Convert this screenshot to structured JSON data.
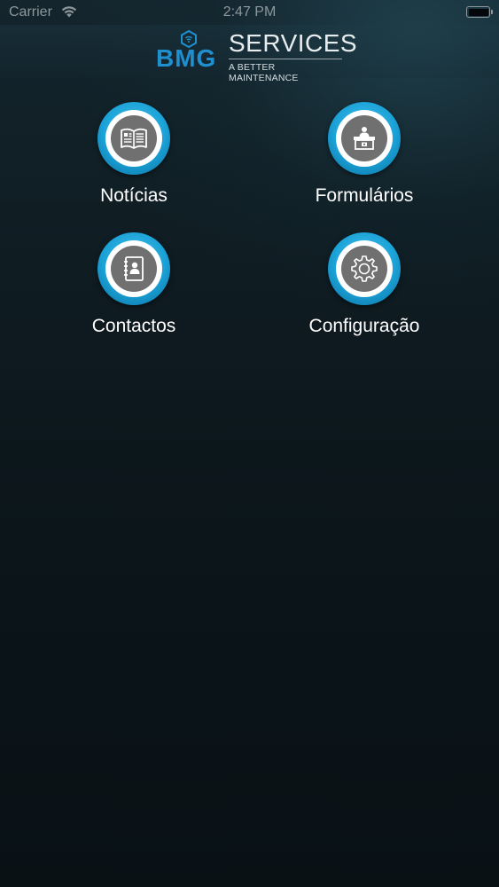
{
  "status_bar": {
    "carrier": "Carrier",
    "time": "2:47 PM",
    "wifi_icon": "wifi-icon",
    "battery_icon": "battery-icon"
  },
  "header": {
    "logo_brand": "BMG",
    "logo_name": "SERVICES",
    "logo_tagline": "A BETTER MAINTENANCE",
    "brand_color": "#1f8fd0"
  },
  "menu": {
    "accent_color": "#1aa1d6",
    "items": [
      {
        "label": "Notícias",
        "icon": "newspaper-icon"
      },
      {
        "label": "Formulários",
        "icon": "desk-form-icon"
      },
      {
        "label": "Contactos",
        "icon": "contact-book-icon"
      },
      {
        "label": "Configuração",
        "icon": "gear-icon"
      }
    ]
  }
}
